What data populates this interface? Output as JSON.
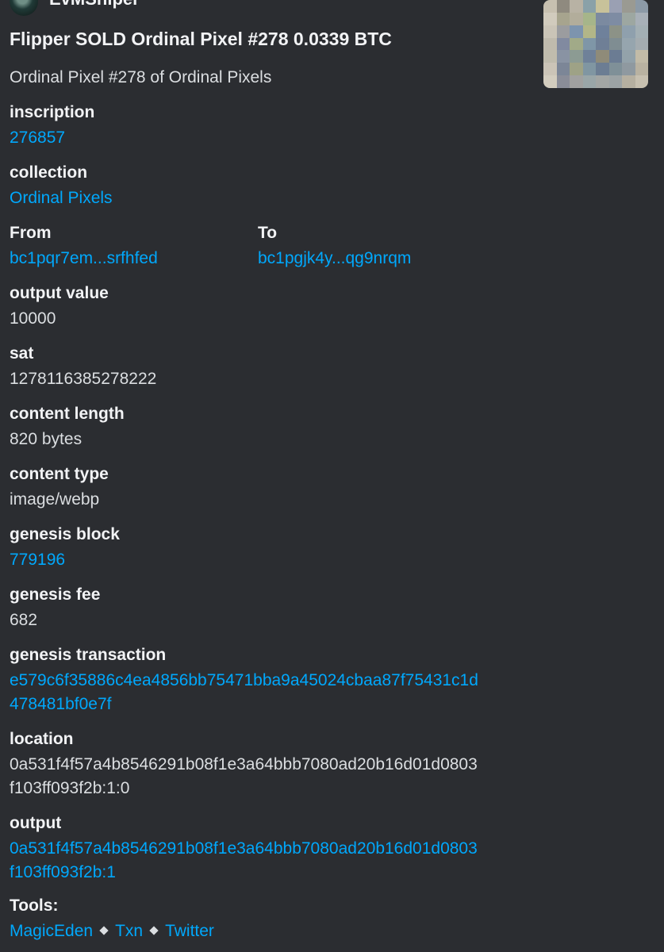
{
  "author": {
    "name": "EvMSniper"
  },
  "embed": {
    "title": "Flipper SOLD Ordinal Pixel #278 0.0339 BTC",
    "subtitle": "Ordinal Pixel #278 of Ordinal Pixels",
    "fields": {
      "inscription": {
        "label": "inscription",
        "value": "276857"
      },
      "collection": {
        "label": "collection",
        "value": "Ordinal Pixels"
      },
      "from": {
        "label": "From",
        "value": "bc1pqr7em...srfhfed"
      },
      "to": {
        "label": "To",
        "value": "bc1pgjk4y...qg9nrqm"
      },
      "output_value": {
        "label": "output value",
        "value": "10000"
      },
      "sat": {
        "label": "sat",
        "value": "1278116385278222"
      },
      "content_length": {
        "label": "content length",
        "value": "820 bytes"
      },
      "content_type": {
        "label": "content type",
        "value": "image/webp"
      },
      "genesis_block": {
        "label": "genesis block",
        "value": "779196"
      },
      "genesis_fee": {
        "label": "genesis fee",
        "value": "682"
      },
      "genesis_transaction": {
        "label": "genesis transaction",
        "line1": "e579c6f35886c4ea4856bb75471bba9a45024cbaa87f75431c1d",
        "line2": "478481bf0e7f"
      },
      "location": {
        "label": "location",
        "line1": "0a531f4f57a4b8546291b08f1e3a64bbb7080ad20b16d01d0803",
        "line2": "f103ff093f2b:1:0"
      },
      "output": {
        "label": "output",
        "line1": "0a531f4f57a4b8546291b08f1e3a64bbb7080ad20b16d01d0803",
        "line2": "f103ff093f2b:1"
      }
    },
    "tools": {
      "label": "Tools:",
      "links": [
        "MagicEden",
        "Txn",
        "Twitter"
      ]
    }
  },
  "colors": {
    "background": "#2b2d31",
    "link": "#00a8fc",
    "text": "#dbdee1",
    "heading": "#f2f3f5"
  }
}
